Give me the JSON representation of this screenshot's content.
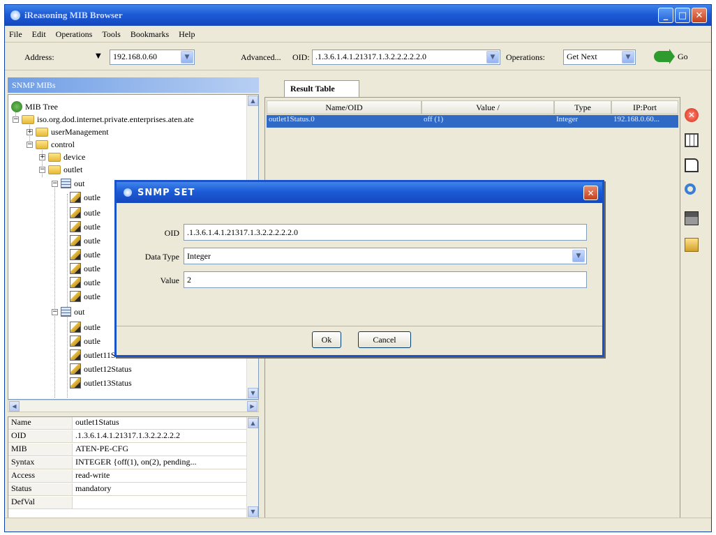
{
  "window": {
    "title": "iReasoning MIB Browser",
    "min_glyph": "_",
    "max_glyph": "□",
    "close_glyph": "✕"
  },
  "menu": [
    "File",
    "Edit",
    "Operations",
    "Tools",
    "Bookmarks",
    "Help"
  ],
  "address_bar": {
    "address_label": "Address:",
    "address_value": "192.168.0.60",
    "advanced_label": "Advanced...",
    "oid_label": "OID:",
    "oid_value": ".1.3.6.1.4.1.21317.1.3.2.2.2.2.2.0",
    "operations_label": "Operations:",
    "operations_value": "Get Next",
    "go_label": "Go"
  },
  "left_panel": {
    "header": "SNMP MIBs",
    "tree": {
      "root": "MIB Tree",
      "path": "iso.org.dod.internet.private.enterprises.aten.ate",
      "user_mgmt": "userManagement",
      "control": "control",
      "device": "device",
      "outlet": "outlet",
      "table_trunc": "out",
      "leaf_trunc": "outle",
      "table2_trunc": "out",
      "leaf_11": "outlet11Status",
      "leaf_12": "outlet12Status",
      "leaf_13": "outlet13Status"
    },
    "properties": [
      {
        "key": "Name",
        "value": "outlet1Status"
      },
      {
        "key": "OID",
        "value": ".1.3.6.1.4.1.21317.1.3.2.2.2.2.2"
      },
      {
        "key": "MIB",
        "value": "ATEN-PE-CFG"
      },
      {
        "key": "Syntax",
        "value": "INTEGER {off(1), on(2), pending..."
      },
      {
        "key": "Access",
        "value": "read-write"
      },
      {
        "key": "Status",
        "value": "mandatory"
      },
      {
        "key": "DefVal",
        "value": ""
      }
    ]
  },
  "result": {
    "tab": "Result Table",
    "columns": [
      "Name/OID",
      "Value /",
      "Type",
      "IP:Port"
    ],
    "rows": [
      {
        "name": "outlet1Status.0",
        "value": "off (1)",
        "type": "Integer",
        "ipport": "192.168.0.60..."
      }
    ]
  },
  "dialog": {
    "title": "SNMP SET",
    "oid_label": "OID",
    "oid_value": ".1.3.6.1.4.1.21317.1.3.2.2.2.2.2.0",
    "datatype_label": "Data Type",
    "datatype_value": "Integer",
    "value_label": "Value",
    "value_value": "2",
    "ok_label": "Ok",
    "cancel_label": "Cancel"
  },
  "icons": {
    "stop": "stop-icon",
    "table": "table-icon",
    "document": "document-icon",
    "find": "find-icon",
    "print": "print-icon",
    "open": "open-folder-icon"
  }
}
